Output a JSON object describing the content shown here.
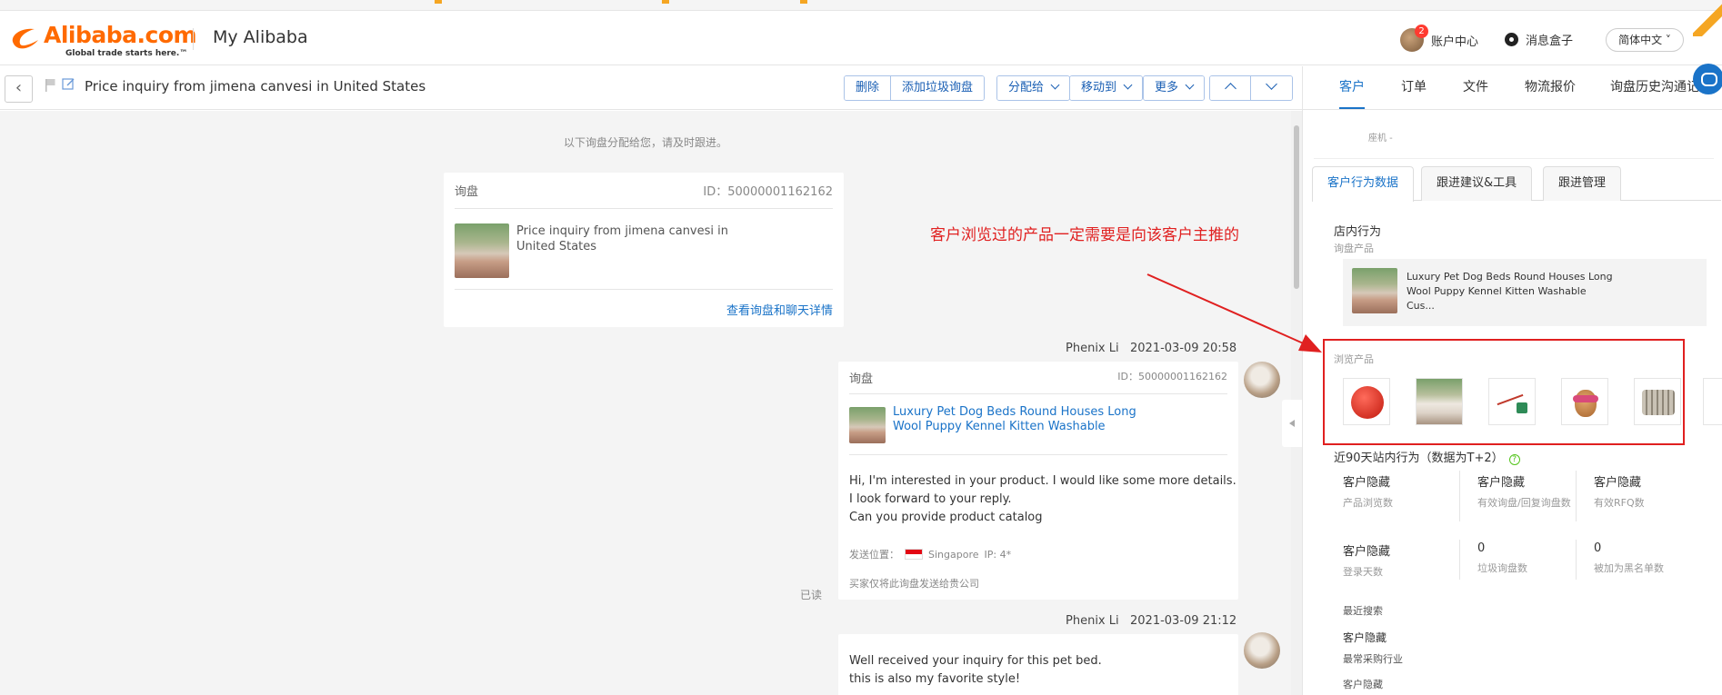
{
  "header": {
    "brand": "Alibaba.com",
    "tagline": "Global trade starts here.™",
    "section": "My Alibaba",
    "account_label": "账户中心",
    "account_badge": "2",
    "messages_label": "消息盒子",
    "language": "简体中文"
  },
  "toolbar": {
    "subject": "Price inquiry from jimena canvesi in United States",
    "buttons": {
      "delete": "删除",
      "spam": "添加垃圾询盘",
      "assign": "分配给",
      "move": "移动到",
      "more": "更多"
    }
  },
  "chat": {
    "notice": "以下询盘分配给您，请及时跟进。",
    "card1": {
      "label": "询盘",
      "id": "ID：50000001162162",
      "text": "Price inquiry from jimena canvesi in United States",
      "link": "查看询盘和聊天详情"
    },
    "msg2": {
      "sender": "Phenix Li",
      "time": "2021-03-09 20:58",
      "label": "询盘",
      "id": "ID：50000001162162",
      "product": "Luxury Pet Dog Beds Round Houses Long Wool Puppy Kennel Kitten Washable",
      "body": [
        "Hi, I'm interested in your product. I would like some more details.",
        "I look forward to your reply.",
        "Can you provide product catalog"
      ],
      "location_label": "发送位置：",
      "location": "Singapore",
      "ip": "IP: 4*",
      "forward_note": "买家仅将此询盘发送给贵公司",
      "read": "已读"
    },
    "msg3": {
      "sender": "Phenix Li",
      "time": "2021-03-09 21:12",
      "body": [
        "Well received your inquiry for this pet bed.",
        " this is also my favorite style!"
      ]
    }
  },
  "annotation": {
    "text": "客户浏览过的产品一定需要是向该客户主推的",
    "color": "#e02020"
  },
  "right_panel": {
    "tabs": [
      "客户",
      "订单",
      "文件",
      "物流报价",
      "询盘历史沟通记录"
    ],
    "cut_text": "座机 -",
    "subtabs": [
      "客户行为数据",
      "跟进建议&工具",
      "跟进管理"
    ],
    "store_behavior": "店内行为",
    "inquiry_products_label": "询盘产品",
    "inquiry_product": "Luxury Pet Dog Beds Round Houses Long Wool Puppy Kennel Kitten Washable Cus...",
    "browse_label": "浏览产品",
    "browse_products": [
      "red-ball-toy",
      "pet-bed",
      "leash",
      "pineapple-toy",
      "rope-toy"
    ],
    "activity_title": "近90天站内行为（数据为T+2）",
    "stats": [
      {
        "value": "客户隐藏",
        "label": "产品浏览数"
      },
      {
        "value": "客户隐藏",
        "label": "有效询盘/回复询盘数"
      },
      {
        "value": "客户隐藏",
        "label": "有效RFQ数"
      },
      {
        "value": "客户隐藏",
        "label": "登录天数"
      },
      {
        "value": "0",
        "label": "垃圾询盘数"
      },
      {
        "value": "0",
        "label": "被加为黑名单数"
      }
    ],
    "recent_search_label": "最近搜索",
    "recent_search_value": "客户隐藏",
    "industry_label": "最常采购行业",
    "bottom_value": "客户隐藏"
  },
  "colors": {
    "brand": "#ff6a00",
    "link": "#1a73c8",
    "highlight": "#e02020"
  }
}
